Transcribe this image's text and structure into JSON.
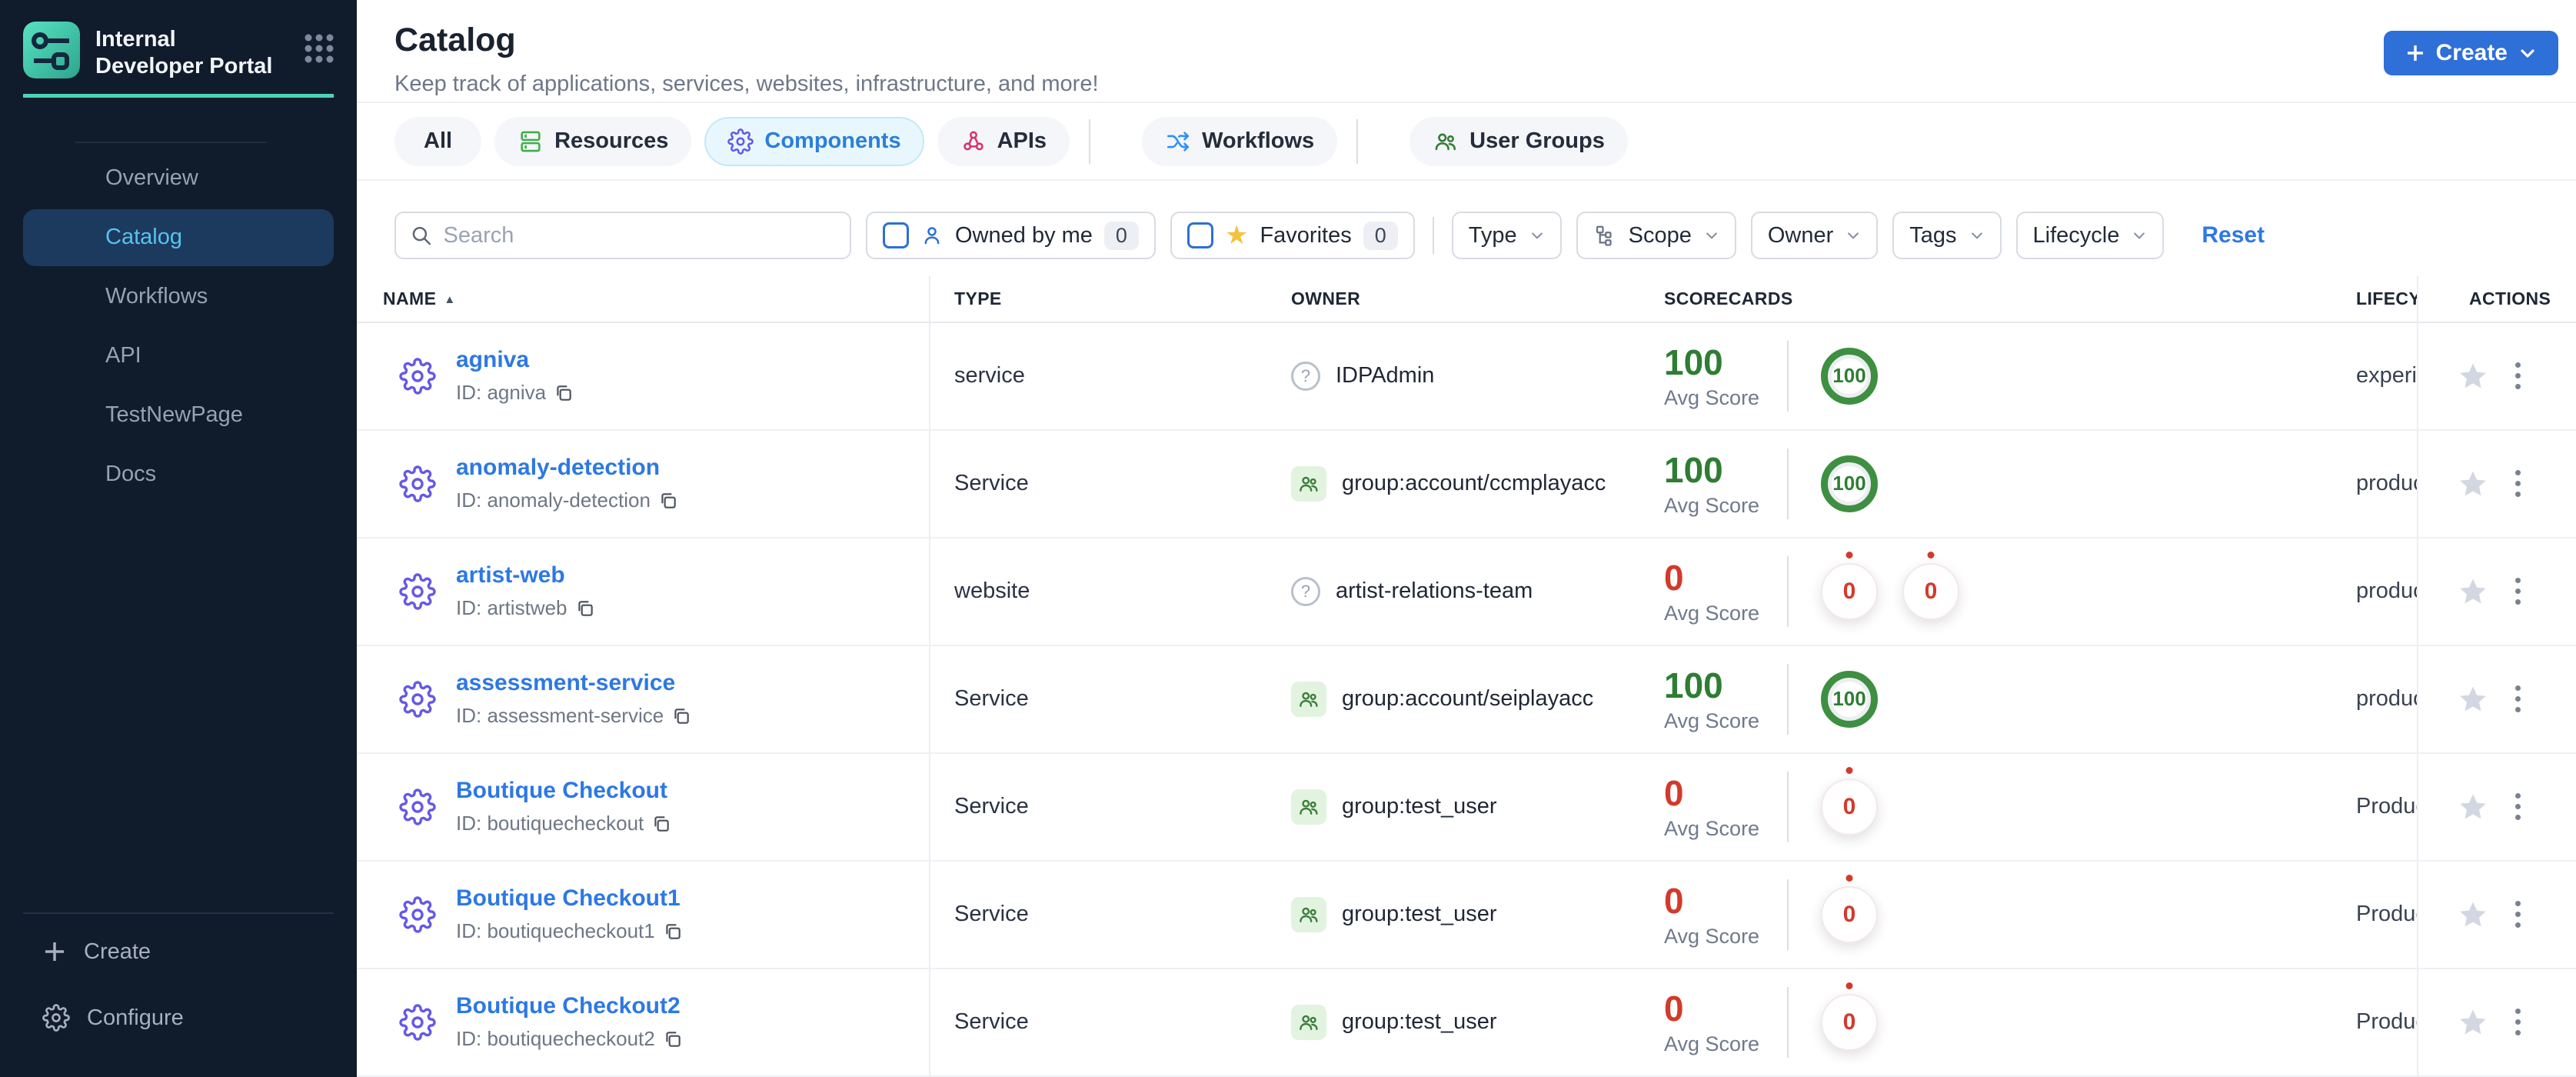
{
  "colors": {
    "sidebar-bg": "#101b2c",
    "sidebar-active-bg": "#1c3a5e",
    "sidebar-active-text": "#55c3ee",
    "accent-teal": "#49d6b2",
    "primary-blue": "#2e6fd8",
    "link-blue": "#2d78e4",
    "tab-active-bg": "#e8f7fd",
    "tab-active-border": "#c3e9f7",
    "green": "#2e7d33",
    "green-ring": "#3e8f41",
    "red": "#d23a2c",
    "gear-violet": "#6459e6",
    "group-icon-green": "#3c7d3c",
    "group-icon-bg": "#e2f3df",
    "star-yellow": "#f5c33b",
    "action-star-gray": "#d3d7e1"
  },
  "sidebar": {
    "logo_title": "Internal Developer Portal",
    "nav": [
      {
        "label": "Overview",
        "active": false
      },
      {
        "label": "Catalog",
        "active": true
      },
      {
        "label": "Workflows",
        "active": false
      },
      {
        "label": "API",
        "active": false
      },
      {
        "label": "TestNewPage",
        "active": false
      },
      {
        "label": "Docs",
        "active": false
      }
    ],
    "footer": {
      "create_label": "Create",
      "configure_label": "Configure"
    }
  },
  "header": {
    "title": "Catalog",
    "subtitle": "Keep track of applications, services, websites, infrastructure, and more!",
    "create_button": "Create"
  },
  "tabs": {
    "items": [
      {
        "label": "All",
        "active": false
      },
      {
        "label": "Resources",
        "active": false
      },
      {
        "label": "Components",
        "active": true
      },
      {
        "label": "APIs",
        "active": false
      },
      {
        "label": "Workflows",
        "active": false
      },
      {
        "label": "User Groups",
        "active": false
      }
    ]
  },
  "filters": {
    "search_placeholder": "Search",
    "owned_by_me": {
      "label": "Owned by me",
      "count": "0"
    },
    "favorites": {
      "label": "Favorites",
      "count": "0"
    },
    "dropdowns": [
      {
        "label": "Type"
      },
      {
        "label": "Scope"
      },
      {
        "label": "Owner"
      },
      {
        "label": "Tags"
      },
      {
        "label": "Lifecycle"
      }
    ],
    "reset_label": "Reset"
  },
  "table": {
    "columns": [
      "NAME",
      "TYPE",
      "OWNER",
      "SCORECARDS",
      "LIFECYCLE",
      "ACTIONS"
    ],
    "sort_asc_icon": "▲",
    "unknown_owner_glyph": "?",
    "avg_score_label": "Avg Score",
    "rows": [
      {
        "name": "agniva",
        "id": "ID: agniva",
        "type": "service",
        "owner": {
          "icon": "help-circle",
          "text": "IDPAdmin"
        },
        "score": "100",
        "score_tone": "good",
        "badges": [
          {
            "value": "100",
            "tone": "good"
          }
        ],
        "lifecycle": "experimental"
      },
      {
        "name": "anomaly-detection",
        "id": "ID: anomaly-detection",
        "type": "Service",
        "owner": {
          "icon": "group",
          "text": "group:account/ccmplayacc"
        },
        "score": "100",
        "score_tone": "good",
        "badges": [
          {
            "value": "100",
            "tone": "good"
          }
        ],
        "lifecycle": "production"
      },
      {
        "name": "artist-web",
        "id": "ID: artistweb",
        "type": "website",
        "owner": {
          "icon": "help-circle",
          "text": "artist-relations-team"
        },
        "score": "0",
        "score_tone": "bad",
        "badges": [
          {
            "value": "0",
            "tone": "zero"
          },
          {
            "value": "0",
            "tone": "zero"
          }
        ],
        "lifecycle": "production"
      },
      {
        "name": "assessment-service",
        "id": "ID: assessment-service",
        "type": "Service",
        "owner": {
          "icon": "group",
          "text": "group:account/seiplayacc"
        },
        "score": "100",
        "score_tone": "good",
        "badges": [
          {
            "value": "100",
            "tone": "good"
          }
        ],
        "lifecycle": "production"
      },
      {
        "name": "Boutique Checkout",
        "id": "ID: boutiquecheckout",
        "type": "Service",
        "owner": {
          "icon": "group",
          "text": "group:test_user"
        },
        "score": "0",
        "score_tone": "bad",
        "badges": [
          {
            "value": "0",
            "tone": "zero"
          }
        ],
        "lifecycle": "Production"
      },
      {
        "name": "Boutique Checkout1",
        "id": "ID: boutiquecheckout1",
        "type": "Service",
        "owner": {
          "icon": "group",
          "text": "group:test_user"
        },
        "score": "0",
        "score_tone": "bad",
        "badges": [
          {
            "value": "0",
            "tone": "zero"
          }
        ],
        "lifecycle": "Production"
      },
      {
        "name": "Boutique Checkout2",
        "id": "ID: boutiquecheckout2",
        "type": "Service",
        "owner": {
          "icon": "group",
          "text": "group:test_user"
        },
        "score": "0",
        "score_tone": "bad",
        "badges": [
          {
            "value": "0",
            "tone": "zero"
          }
        ],
        "lifecycle": "Production"
      }
    ]
  }
}
